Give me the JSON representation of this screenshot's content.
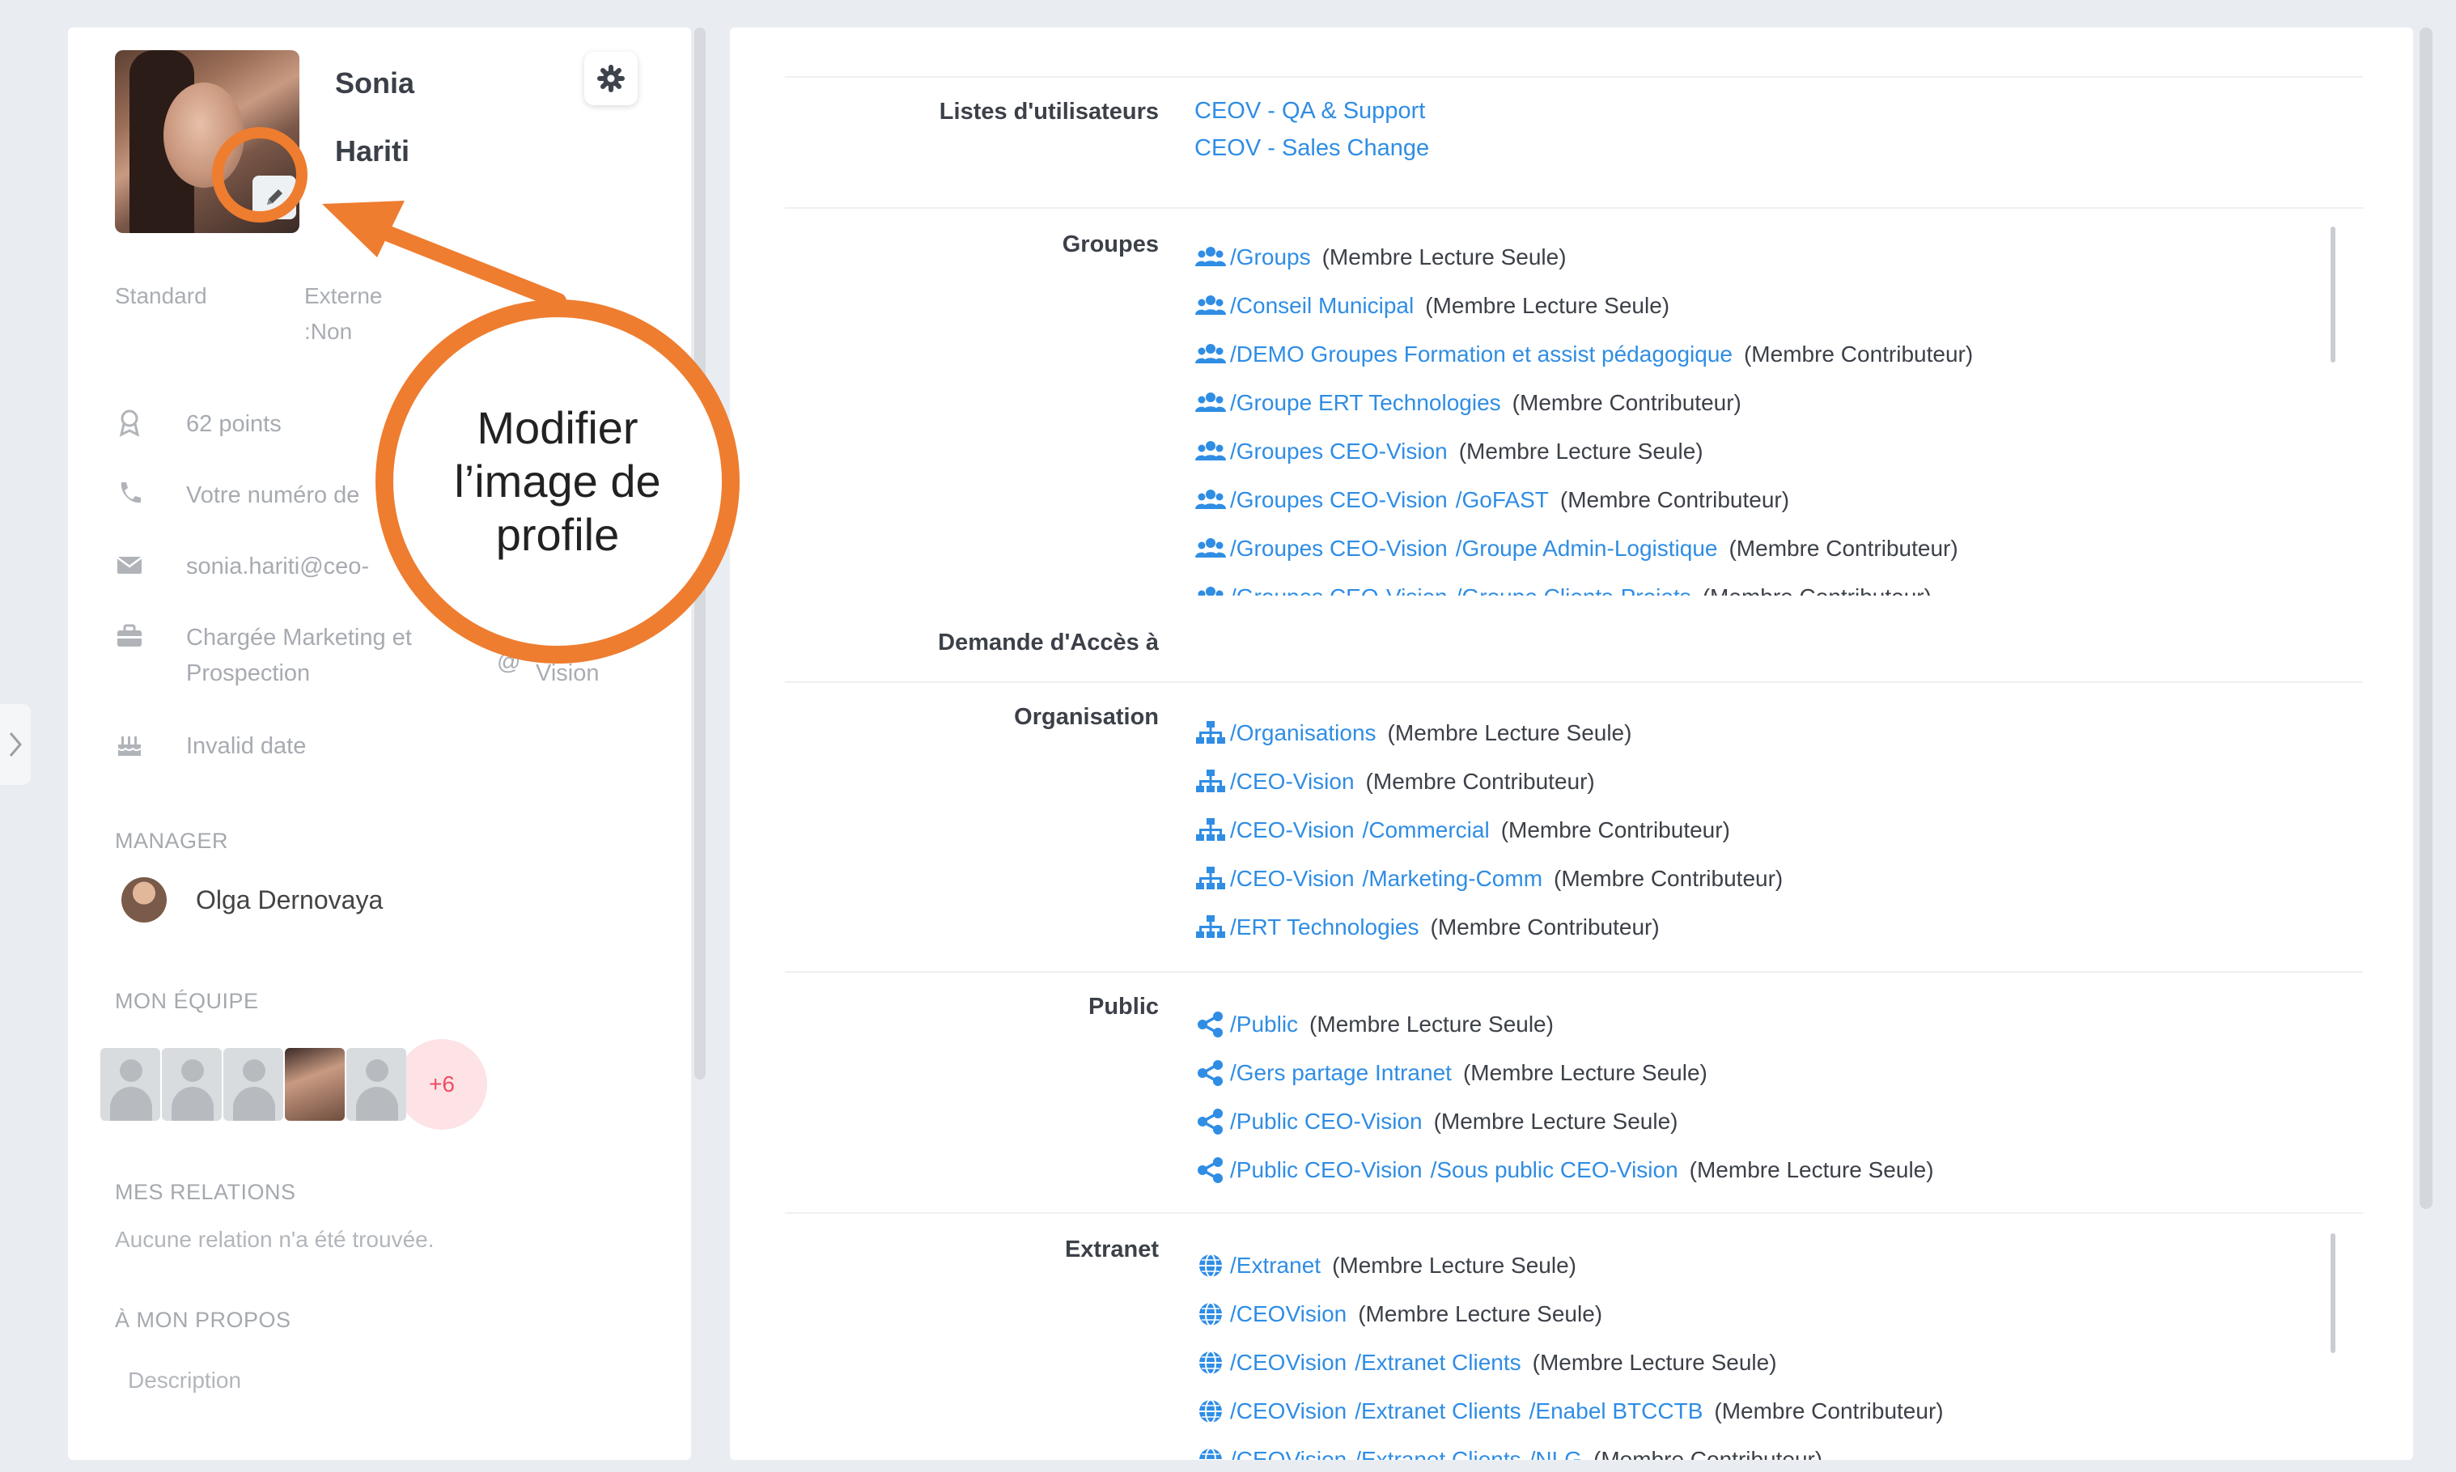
{
  "profile": {
    "first_name": "Sonia",
    "last_name": "Hariti",
    "account_type": "Standard",
    "external": "Externe",
    "external_value": ":Non",
    "points": "62 points",
    "phone_placeholder": "Votre numéro de",
    "email": "sonia.hariti@ceo-",
    "job_line1": "Chargée Marketing et",
    "job_line2": "Prospection",
    "company_at": "@",
    "company_name": "Vision",
    "birthday": "Invalid date"
  },
  "manager": {
    "title": "MANAGER",
    "name": "Olga Dernovaya"
  },
  "team": {
    "title": "MON ÉQUIPE",
    "more": "+6"
  },
  "relations": {
    "title": "MES RELATIONS",
    "empty": "Aucune relation n'a été trouvée."
  },
  "about": {
    "title": "À MON PROPOS",
    "description": "Description"
  },
  "annotation": {
    "line1": "Modifier",
    "line2": "l’image de",
    "line3": "profile",
    "color": "#ee7d30"
  },
  "memberships": {
    "user_lists": {
      "label": "Listes d'utilisateurs",
      "items": [
        "CEOV - QA & Support",
        "CEOV - Sales Change"
      ]
    },
    "groups": {
      "label": "Groupes",
      "items": [
        {
          "path": [
            "/Groups"
          ],
          "role": "(Membre Lecture Seule)"
        },
        {
          "path": [
            "/Conseil Municipal"
          ],
          "role": "(Membre Lecture Seule)"
        },
        {
          "path": [
            "/DEMO Groupes Formation et assist pédagogique"
          ],
          "role": "(Membre Contributeur)"
        },
        {
          "path": [
            "/Groupe ERT Technologies"
          ],
          "role": "(Membre Contributeur)"
        },
        {
          "path": [
            "/Groupes CEO-Vision"
          ],
          "role": "(Membre Lecture Seule)"
        },
        {
          "path": [
            "/Groupes CEO-Vision",
            "/GoFAST"
          ],
          "role": "(Membre Contributeur)"
        },
        {
          "path": [
            "/Groupes CEO-Vision",
            "/Groupe Admin-Logistique"
          ],
          "role": "(Membre Contributeur)"
        },
        {
          "path": [
            "/Groupes CEO-Vision",
            "/Groupe Clients-Projets"
          ],
          "role": "(Membre Contributeur)"
        }
      ]
    },
    "access_request": {
      "label": "Demande d'Accès à"
    },
    "organisation": {
      "label": "Organisation",
      "items": [
        {
          "path": [
            "/Organisations"
          ],
          "role": "(Membre Lecture Seule)"
        },
        {
          "path": [
            "/CEO-Vision"
          ],
          "role": "(Membre Contributeur)"
        },
        {
          "path": [
            "/CEO-Vision",
            "/Commercial"
          ],
          "role": "(Membre Contributeur)"
        },
        {
          "path": [
            "/CEO-Vision",
            "/Marketing-Comm"
          ],
          "role": "(Membre Contributeur)"
        },
        {
          "path": [
            "/ERT Technologies"
          ],
          "role": "(Membre Contributeur)"
        }
      ]
    },
    "public": {
      "label": "Public",
      "items": [
        {
          "path": [
            "/Public"
          ],
          "role": "(Membre Lecture Seule)"
        },
        {
          "path": [
            "/Gers partage Intranet"
          ],
          "role": "(Membre Lecture Seule)"
        },
        {
          "path": [
            "/Public CEO-Vision"
          ],
          "role": "(Membre Lecture Seule)"
        },
        {
          "path": [
            "/Public CEO-Vision",
            "/Sous public CEO-Vision"
          ],
          "role": "(Membre Lecture Seule)"
        }
      ]
    },
    "extranet": {
      "label": "Extranet",
      "items": [
        {
          "path": [
            "/Extranet"
          ],
          "role": "(Membre Lecture Seule)"
        },
        {
          "path": [
            "/CEOVision"
          ],
          "role": "(Membre Lecture Seule)"
        },
        {
          "path": [
            "/CEOVision",
            "/Extranet Clients"
          ],
          "role": "(Membre Lecture Seule)"
        },
        {
          "path": [
            "/CEOVision",
            "/Extranet Clients",
            "/Enabel BTCCTB"
          ],
          "role": "(Membre Contributeur)"
        },
        {
          "path": [
            "/CEOVision",
            "/Extranet Clients",
            "/NLG"
          ],
          "role": "(Membre Contributeur)"
        }
      ]
    }
  }
}
